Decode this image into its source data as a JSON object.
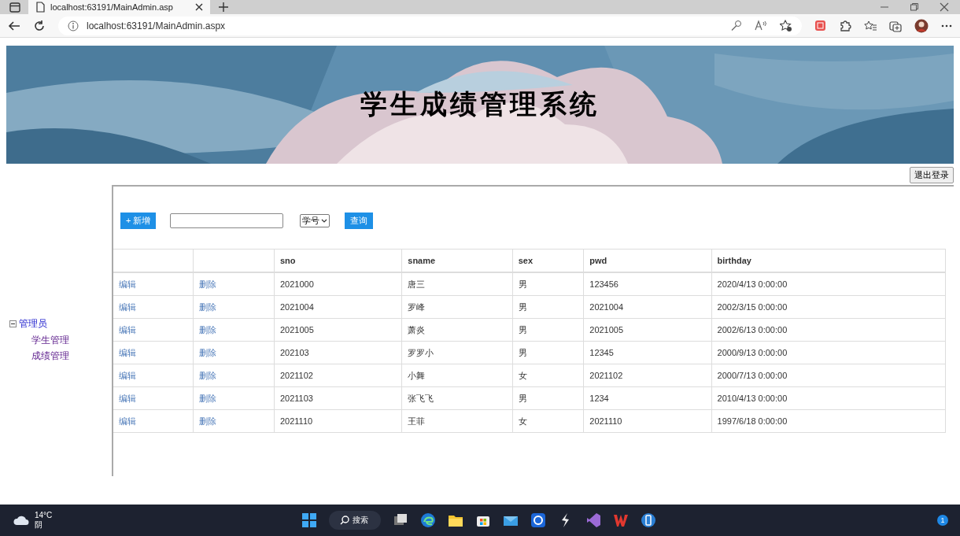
{
  "browser": {
    "tab": {
      "title": "localhost:63191/MainAdmin.asp",
      "selected": true
    },
    "address": "localhost:63191/MainAdmin.aspx"
  },
  "banner": {
    "title": "学生成绩管理系统"
  },
  "logout_button": "退出登录",
  "tree": {
    "label": "管理员",
    "expanded": true,
    "children": [
      {
        "label": "学生管理"
      },
      {
        "label": "成绩管理"
      }
    ]
  },
  "toolbar": {
    "add_button": "+ 新增",
    "field_select": "学号",
    "query_button": "查询"
  },
  "table": {
    "columns": [
      "",
      "",
      "sno",
      "sname",
      "sex",
      "pwd",
      "birthday"
    ],
    "rows": [
      {
        "cells": [
          "编辑",
          "删除",
          "2021000",
          "唐三",
          "男",
          "123456",
          "2020/4/13 0:00:00"
        ]
      },
      {
        "cells": [
          "编辑",
          "删除",
          "2021004",
          "罗峰",
          "男",
          "2021004",
          "2002/3/15 0:00:00"
        ]
      },
      {
        "cells": [
          "编辑",
          "删除",
          "2021005",
          "萧炎",
          "男",
          "2021005",
          "2002/6/13 0:00:00"
        ]
      },
      {
        "cells": [
          "编辑",
          "删除",
          "202103",
          "罗罗小",
          "男",
          "12345",
          "2000/9/13 0:00:00"
        ]
      },
      {
        "cells": [
          "编辑",
          "删除",
          "2021102",
          "小舞",
          "女",
          "2021102",
          "2000/7/13 0:00:00"
        ]
      },
      {
        "cells": [
          "编辑",
          "删除",
          "2021103",
          "张飞飞",
          "男",
          "1234",
          "2010/4/13 0:00:00"
        ]
      },
      {
        "cells": [
          "编辑",
          "删除",
          "2021110",
          "王菲",
          "女",
          "2021110",
          "1997/6/18 0:00:00"
        ]
      }
    ]
  },
  "taskbar": {
    "weather": {
      "temperature": "14°C",
      "condition": "阴"
    },
    "search": "搜索",
    "notifications": "1"
  }
}
